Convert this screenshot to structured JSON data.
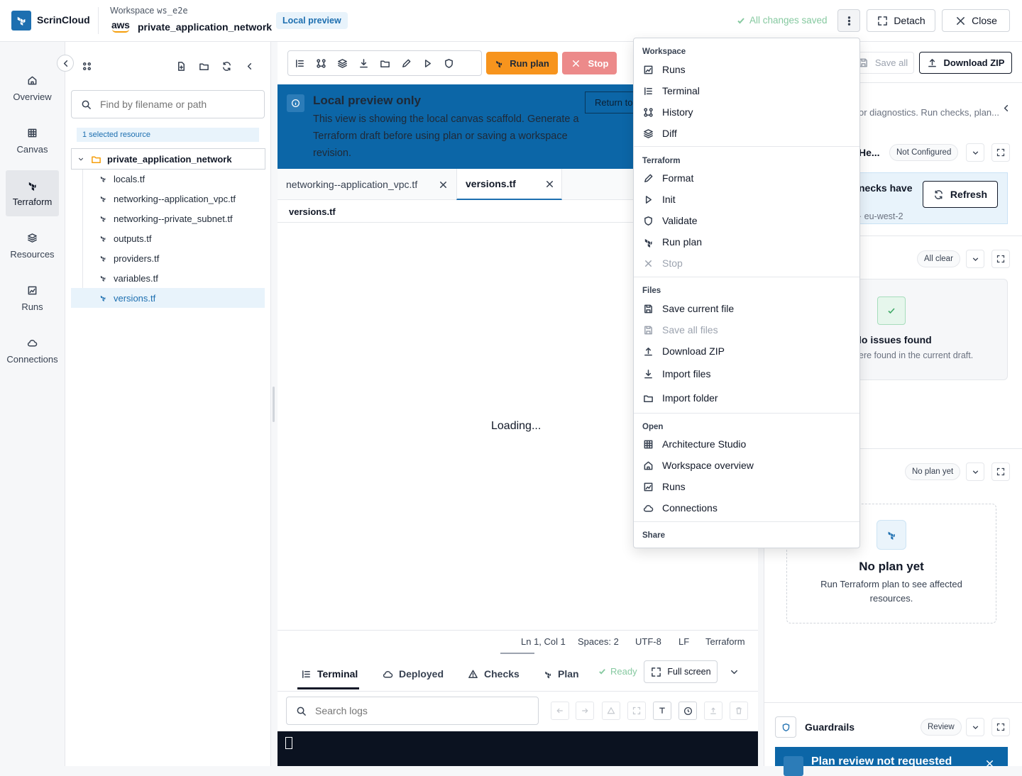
{
  "header": {
    "brand": "ScrinCloud",
    "workspace_label": "Workspace",
    "workspace_id": "ws_e2e",
    "provider": "aws",
    "workspace_name": "private_application_network",
    "mode_badge": "Local preview",
    "save_status": "All changes saved",
    "detach_label": "Detach",
    "close_label": "Close"
  },
  "nav": {
    "items": [
      {
        "label": "Overview",
        "icon": "home-icon"
      },
      {
        "label": "Canvas",
        "icon": "grid-icon"
      },
      {
        "label": "Terraform",
        "icon": "terraform-icon"
      },
      {
        "label": "Resources",
        "icon": "layers-icon"
      },
      {
        "label": "Runs",
        "icon": "chart-icon"
      },
      {
        "label": "Connections",
        "icon": "cloud-icon"
      }
    ],
    "active": "Terraform"
  },
  "files": {
    "search_placeholder": "Find by filename or path",
    "selected_resource": "1 selected resource",
    "root": "private_application_network",
    "items": [
      "locals.tf",
      "networking--application_vpc.tf",
      "networking--private_subnet.tf",
      "outputs.tf",
      "providers.tf",
      "variables.tf",
      "versions.tf"
    ],
    "active_file": "versions.tf"
  },
  "editor": {
    "run_plan_label": "Run plan",
    "stop_label": "Stop",
    "banner_title": "Local preview only",
    "banner_text": "This view is showing the local canvas scaffold. Generate a Terraform draft before using plan or saving a workspace revision.",
    "return_label": "Return to",
    "tabs": [
      "networking--application_vpc.tf",
      "versions.tf"
    ],
    "active_tab": "versions.tf",
    "breadcrumb": "versions.tf",
    "loading": "Loading...",
    "status": {
      "position": "Ln 1, Col 1",
      "spaces": "Spaces: 2",
      "encoding": "UTF-8",
      "eol": "LF",
      "language": "Terraform"
    }
  },
  "bottom": {
    "tabs": [
      "Terminal",
      "Deployed",
      "Checks",
      "Plan"
    ],
    "active_tab": "Terminal",
    "ready": "Ready",
    "fullscreen": "Full screen",
    "log_search_placeholder": "Search logs"
  },
  "right": {
    "save_all": "Save all",
    "download_zip": "Download ZIP",
    "diagnostics_text": "or diagnostics. Run checks, plan...",
    "health_label": "He...",
    "health_pill": "Not Configured",
    "checks_text": "necks have",
    "region_text": "· eu-west-2",
    "refresh": "Refresh",
    "checks_pill": "All clear",
    "no_issues_title": "lo issues found",
    "no_issues_sub": "ere found in the current draft.",
    "plan_pill": "No plan yet",
    "no_plan_title": "No plan yet",
    "no_plan_sub": "Run Terraform plan to see affected resources.",
    "guardrails": "Guardrails",
    "guardrails_pill": "Review",
    "guard_banner": "Plan review not requested"
  },
  "menu": {
    "sections": [
      {
        "title": "Workspace",
        "items": [
          {
            "label": "Runs",
            "icon": "chart-icon"
          },
          {
            "label": "Terminal",
            "icon": "terminal-icon"
          },
          {
            "label": "History",
            "icon": "history-icon"
          },
          {
            "label": "Diff",
            "icon": "layers-icon"
          }
        ]
      },
      {
        "title": "Terraform",
        "items": [
          {
            "label": "Format",
            "icon": "pen-icon"
          },
          {
            "label": "Init",
            "icon": "play-icon"
          },
          {
            "label": "Validate",
            "icon": "shield-icon"
          },
          {
            "label": "Run plan",
            "icon": "terraform-icon"
          },
          {
            "label": "Stop",
            "icon": "x-icon",
            "disabled": true
          }
        ]
      },
      {
        "title": "Files",
        "items": [
          {
            "label": "Save current file",
            "icon": "save-icon"
          },
          {
            "label": "Save all files",
            "icon": "save-icon",
            "disabled": true
          },
          {
            "label": "Download ZIP",
            "icon": "upload-icon"
          },
          {
            "label": "Import files",
            "icon": "download-icon"
          },
          {
            "label": "Import folder",
            "icon": "folder-icon"
          }
        ]
      },
      {
        "title": "Open",
        "items": [
          {
            "label": "Architecture Studio",
            "icon": "grid-icon"
          },
          {
            "label": "Workspace overview",
            "icon": "home-icon"
          },
          {
            "label": "Runs",
            "icon": "chart-icon"
          },
          {
            "label": "Connections",
            "icon": "cloud-icon"
          }
        ]
      },
      {
        "title": "Share",
        "items": []
      }
    ]
  },
  "colors": {
    "accent": "#1d6fb0",
    "run_plan": "#f7941d",
    "stop": "#ec8a8a",
    "banner": "#0c66a7",
    "ok": "#86c9a0"
  }
}
